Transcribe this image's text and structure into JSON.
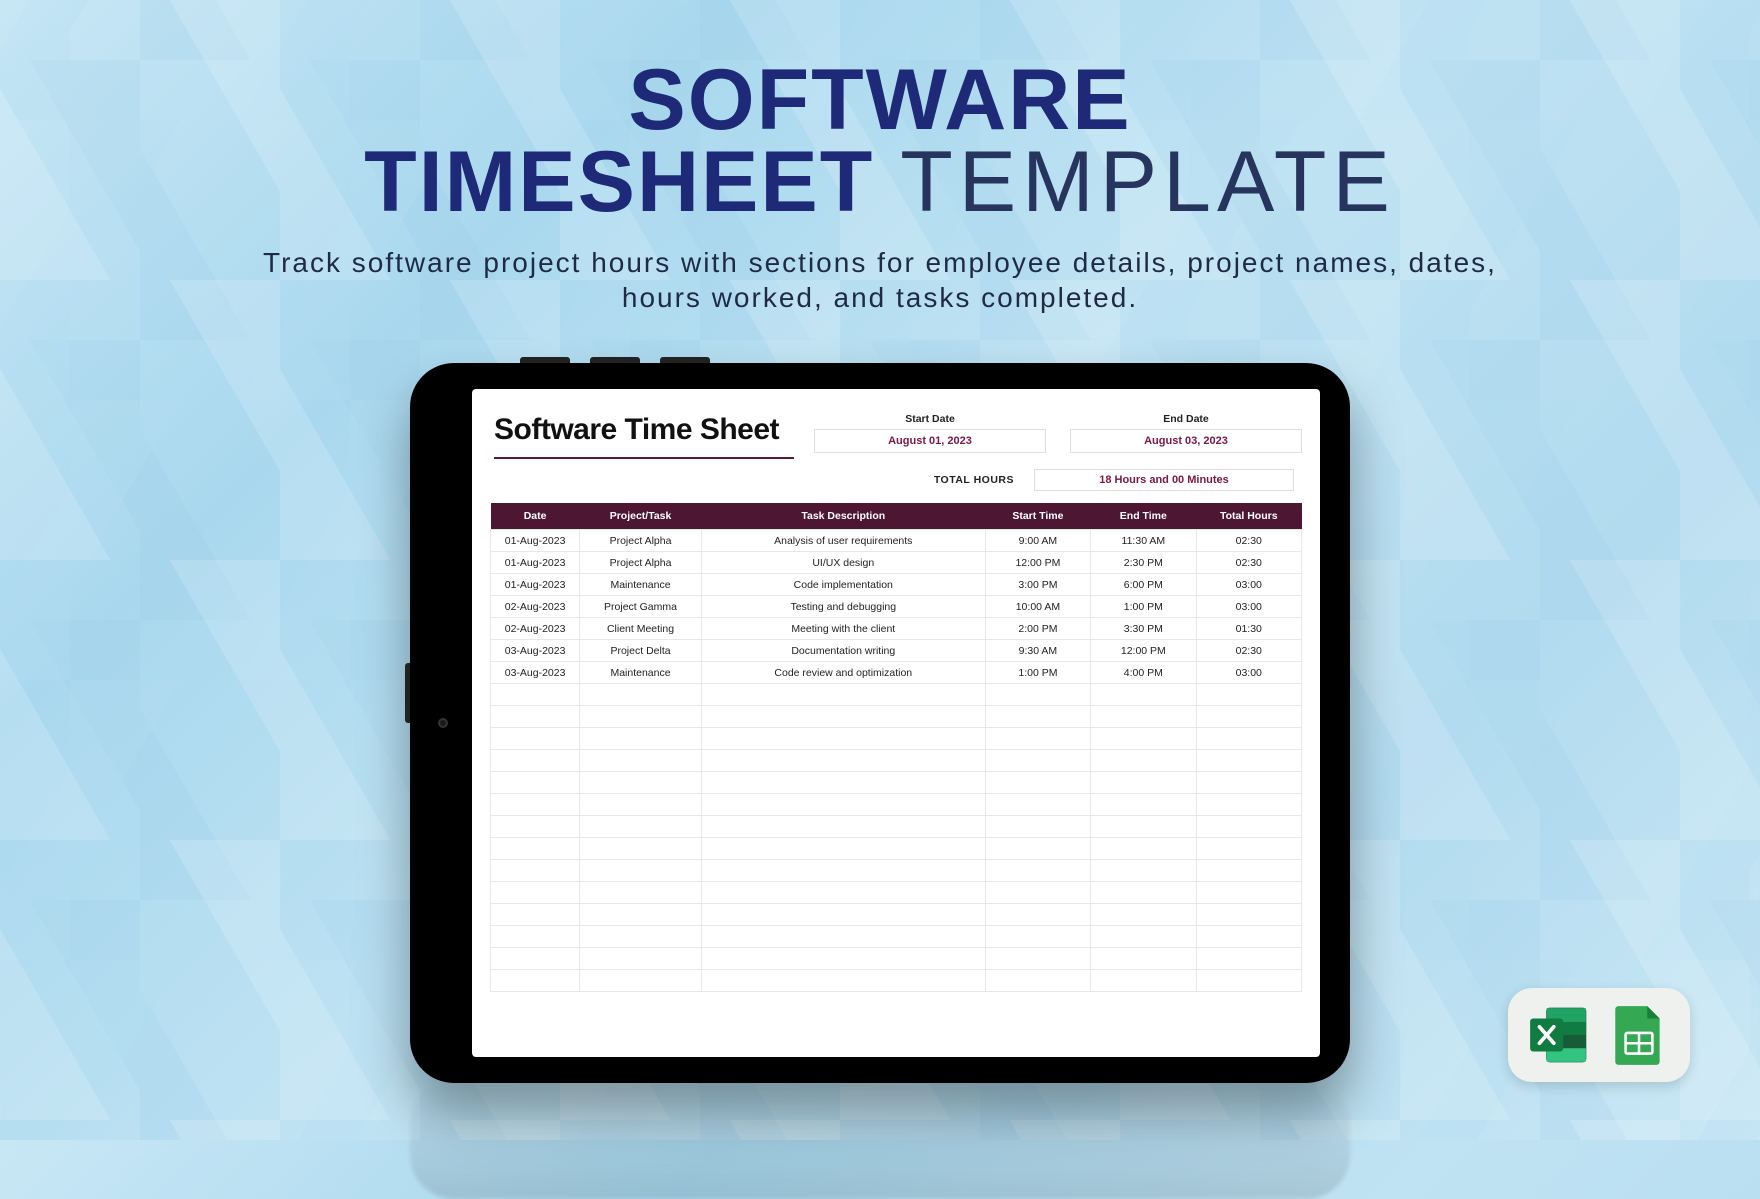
{
  "headline": {
    "line1": "SOFTWARE",
    "line2a": "TIMESHEET",
    "line2b": "TEMPLATE"
  },
  "subhead": "Track software project hours with sections for employee details, project names, dates, hours worked, and tasks completed.",
  "sheet": {
    "title": "Software Time Sheet",
    "start_date_label": "Start Date",
    "start_date": "August 01, 2023",
    "end_date_label": "End Date",
    "end_date": "August 03, 2023",
    "total_hours_label": "TOTAL HOURS",
    "total_hours_value": "18 Hours and 00 Minutes",
    "columns": [
      "Date",
      "Project/Task",
      "Task Description",
      "Start Time",
      "End Time",
      "Total Hours"
    ],
    "rows": [
      {
        "date": "01-Aug-2023",
        "project": "Project Alpha",
        "desc": "Analysis of user requirements",
        "start": "9:00 AM",
        "end": "11:30 AM",
        "total": "02:30"
      },
      {
        "date": "01-Aug-2023",
        "project": "Project Alpha",
        "desc": "UI/UX design",
        "start": "12:00 PM",
        "end": "2:30 PM",
        "total": "02:30"
      },
      {
        "date": "01-Aug-2023",
        "project": "Maintenance",
        "desc": "Code implementation",
        "start": "3:00 PM",
        "end": "6:00 PM",
        "total": "03:00"
      },
      {
        "date": "02-Aug-2023",
        "project": "Project Gamma",
        "desc": "Testing and debugging",
        "start": "10:00 AM",
        "end": "1:00 PM",
        "total": "03:00"
      },
      {
        "date": "02-Aug-2023",
        "project": "Client Meeting",
        "desc": "Meeting with the client",
        "start": "2:00 PM",
        "end": "3:30 PM",
        "total": "01:30"
      },
      {
        "date": "03-Aug-2023",
        "project": "Project Delta",
        "desc": "Documentation writing",
        "start": "9:30 AM",
        "end": "12:00 PM",
        "total": "02:30"
      },
      {
        "date": "03-Aug-2023",
        "project": "Maintenance",
        "desc": "Code review and optimization",
        "start": "1:00 PM",
        "end": "4:00 PM",
        "total": "03:00"
      }
    ],
    "empty_rows": 14
  },
  "badges": {
    "excel": "Microsoft Excel",
    "sheets": "Google Sheets"
  }
}
